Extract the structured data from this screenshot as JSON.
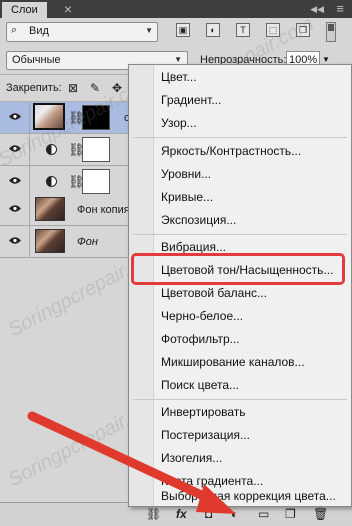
{
  "panel": {
    "title": "Слои",
    "close_glyph": "×",
    "collapse_glyph": "◀◀",
    "window_close_glyph": "≡"
  },
  "filter": {
    "kind_label": "Вид",
    "icons": [
      "image-filter-icon",
      "adjustment-filter-icon",
      "type-filter-icon",
      "shape-filter-icon",
      "smart-object-filter-icon"
    ],
    "icon_glyphs": [
      "▣",
      "◐",
      "T",
      "⬚",
      "❐"
    ]
  },
  "blend": {
    "mode": "Обычные",
    "opacity_label": "Непрозрачность:",
    "opacity_value": "100%"
  },
  "lock": {
    "label": "Закрепить:",
    "glyphs": [
      "⊠",
      "✎",
      "✥"
    ]
  },
  "layers": [
    {
      "name": "с",
      "type": "photo-with-mask",
      "mask": "black",
      "selected": true,
      "visible": true
    },
    {
      "name": "",
      "type": "adjustment",
      "mask": "white",
      "selected": false,
      "visible": true
    },
    {
      "name": "",
      "type": "adjustment",
      "mask": "white",
      "selected": false,
      "visible": true
    },
    {
      "name": "Фон копия",
      "type": "photo",
      "selected": false,
      "visible": true
    },
    {
      "name": "Фон",
      "type": "photo",
      "selected": false,
      "visible": true,
      "italic": true
    }
  ],
  "menu": {
    "items": [
      "Цвет...",
      "Градиент...",
      "Узор...",
      "Яркость/Контрастность...",
      "Уровни...",
      "Кривые...",
      "Экспозиция...",
      "Вибрация...",
      "Цветовой тон/Насыщенность...",
      "Цветовой баланс...",
      "Черно-белое...",
      "Фотофильтр...",
      "Микширование каналов...",
      "Поиск цвета...",
      "Инвертировать",
      "Постеризация...",
      "Изогелия...",
      "Карта градиента...",
      "Выборочная коррекция цвета..."
    ],
    "highlighted": "Цветовой тон/Насыщенность..."
  },
  "bottom_bar": {
    "icons": [
      "link-icon",
      "fx-icon",
      "mask-icon",
      "adjustment-layer-icon",
      "group-icon",
      "new-layer-icon",
      "trash-icon"
    ],
    "fx_label": "fx"
  },
  "watermark": "Soringpcrepair.com",
  "colors": {
    "highlight": "#e33b3b",
    "arrow": "#e03a2e",
    "selected_layer": "#aabbe2"
  }
}
